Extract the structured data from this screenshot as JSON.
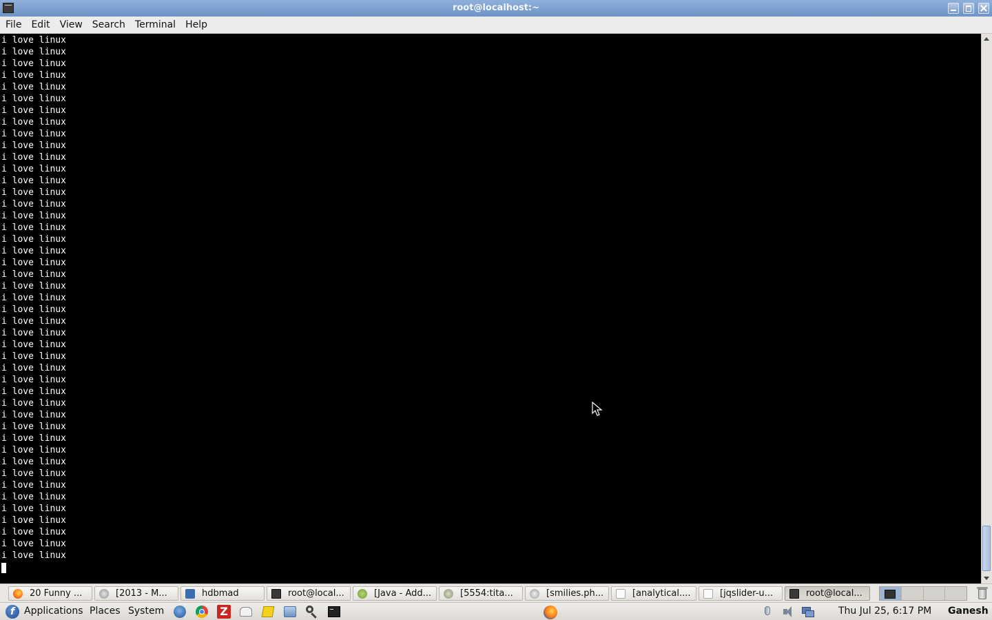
{
  "window": {
    "title": "root@localhost:~"
  },
  "menubar": {
    "items": [
      "File",
      "Edit",
      "View",
      "Search",
      "Terminal",
      "Help"
    ]
  },
  "terminal": {
    "output_line": "i love linux",
    "line_count": 45,
    "background": "#000000",
    "foreground": "#ffffff"
  },
  "taskbar": {
    "tasks": [
      {
        "label": "20 Funny ...",
        "icon": "firefox-icon"
      },
      {
        "label": "[2013 - M...",
        "icon": "chat-icon"
      },
      {
        "label": "hdbmad",
        "icon": "folder-icon"
      },
      {
        "label": "root@local...",
        "icon": "terminal-icon"
      },
      {
        "label": "[Java - Add...",
        "icon": "android-icon"
      },
      {
        "label": "[5554:tita...",
        "icon": "emulator-icon"
      },
      {
        "label": "[smilies.ph...",
        "icon": "smiley-icon"
      },
      {
        "label": "[analytical....",
        "icon": "document-icon"
      },
      {
        "label": "[jqslider-u...",
        "icon": "document-icon"
      },
      {
        "label": "root@local...",
        "icon": "terminal-icon",
        "active": true
      }
    ],
    "workspaces": 4,
    "current_workspace": 1
  },
  "panel": {
    "menus": [
      "Applications",
      "Places",
      "System"
    ],
    "launchers": [
      "thunderbird-icon",
      "chrome-icon",
      "filezilla-icon",
      "mail-icon",
      "notes-icon",
      "file-manager-icon",
      "search-icon",
      "terminal-icon",
      "firefox-icon"
    ],
    "clock": "Thu Jul 25,  6:17 PM",
    "user": "Ganesh"
  },
  "colors": {
    "titlebar": "#7a9dcd",
    "menubar": "#edeceb",
    "scrollbar_thumb": "#a9c0e2"
  }
}
